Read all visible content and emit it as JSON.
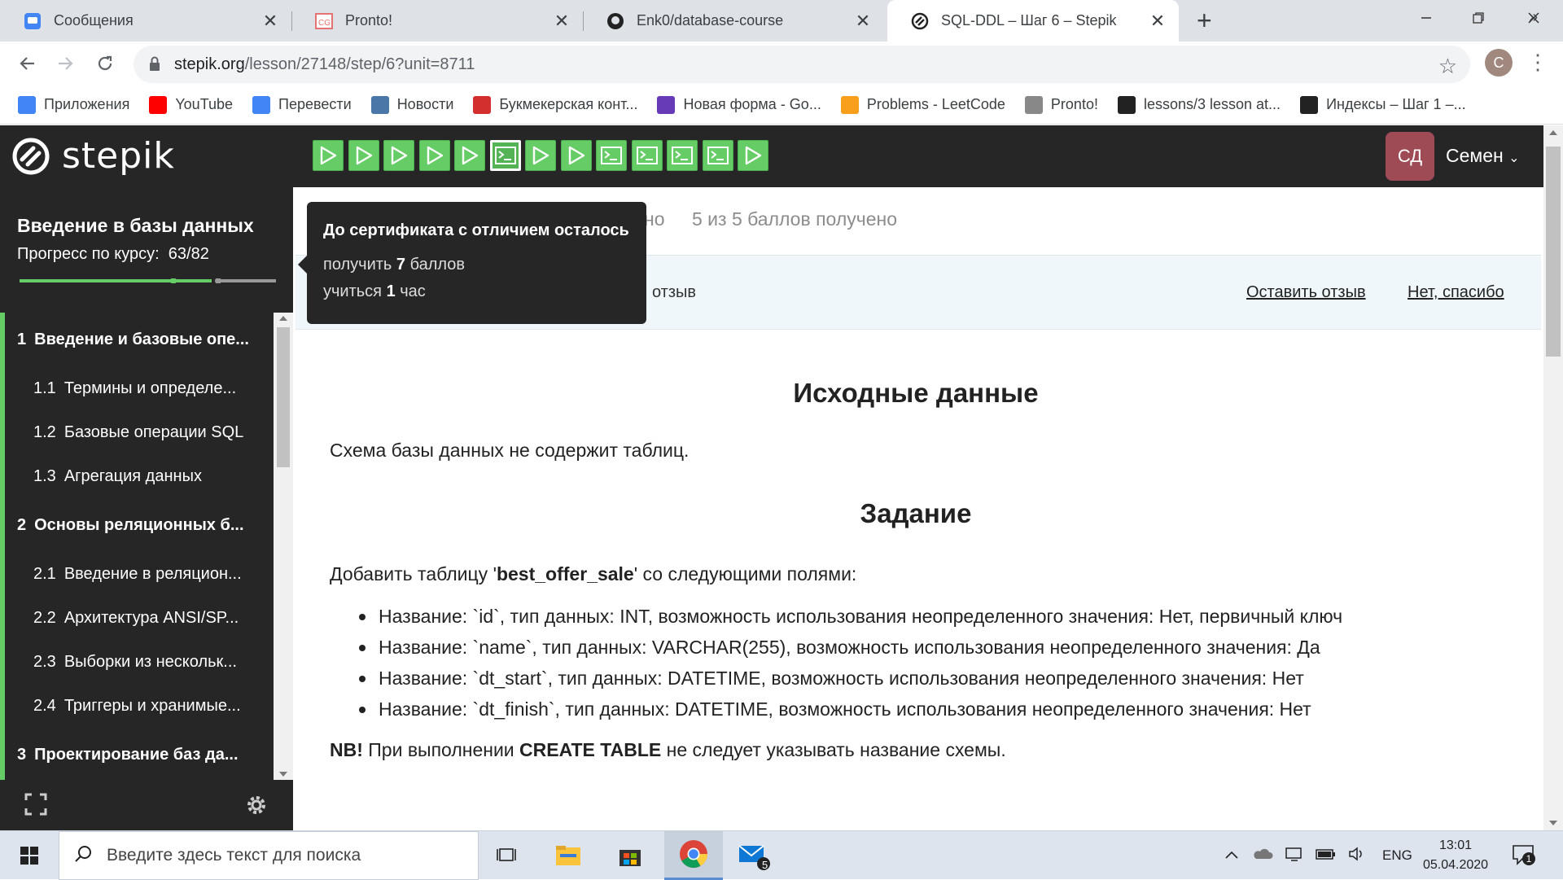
{
  "browser": {
    "tabs": [
      {
        "title": "Сообщения",
        "icon": "messages-icon",
        "active": false
      },
      {
        "title": "Pronto!",
        "icon": "cg-icon",
        "active": false
      },
      {
        "title": "Enk0/database-course",
        "icon": "github-icon",
        "active": false
      },
      {
        "title": "SQL-DDL – Шаг 6 – Stepik",
        "icon": "stepik-icon",
        "active": true
      }
    ],
    "new_tab": "+",
    "url_host": "stepik.org",
    "url_path": "/lesson/27148/step/6?unit=8711",
    "profile_initial": "С",
    "bookmarks": [
      {
        "label": "Приложения",
        "icon": "apps-icon",
        "color": "#4285f4"
      },
      {
        "label": "YouTube",
        "icon": "youtube-icon",
        "color": "#ff0000"
      },
      {
        "label": "Перевести",
        "icon": "translate-icon",
        "color": "#4285f4"
      },
      {
        "label": "Новости",
        "icon": "vk-icon",
        "color": "#4a76a8"
      },
      {
        "label": "Букмекерская конт...",
        "icon": "bookmaker-icon",
        "color": "#d32f2f"
      },
      {
        "label": "Новая форма - Go...",
        "icon": "forms-icon",
        "color": "#673ab7"
      },
      {
        "label": "Problems - LeetCode",
        "icon": "leetcode-icon",
        "color": "#f89f1b"
      },
      {
        "label": "Pronto!",
        "icon": "cg-icon",
        "color": "#888888"
      },
      {
        "label": "lessons/3 lesson at...",
        "icon": "github-icon",
        "color": "#222222"
      },
      {
        "label": "Индексы – Шаг 1 –...",
        "icon": "stepik-icon",
        "color": "#222222"
      }
    ],
    "bookmarks_more": "»"
  },
  "stepik": {
    "logo": "stepik",
    "steps": [
      "passed",
      "passed",
      "passed",
      "passed",
      "passed",
      "code-current",
      "passed",
      "passed",
      "code",
      "code",
      "code",
      "code",
      "passed"
    ],
    "user_initials": "СД",
    "user_name": "Семен",
    "user_caret": "⌄"
  },
  "sidebar": {
    "course_title": "Введение в базы данных",
    "progress_label": "Прогресс по курсу:",
    "progress_value": "63/82",
    "progress_fraction": 0.768,
    "toc": [
      {
        "type": "section",
        "num": "1",
        "label": "Введение и базовые опе..."
      },
      {
        "type": "lesson",
        "num": "1.1",
        "label": "Термины и определе..."
      },
      {
        "type": "lesson",
        "num": "1.2",
        "label": "Базовые операции SQL"
      },
      {
        "type": "lesson",
        "num": "1.3",
        "label": "Агрегация данных"
      },
      {
        "type": "section",
        "num": "2",
        "label": "Основы реляционных б..."
      },
      {
        "type": "lesson",
        "num": "2.1",
        "label": "Введение в реляцион..."
      },
      {
        "type": "lesson",
        "num": "2.2",
        "label": "Архитектура ANSI/SP..."
      },
      {
        "type": "lesson",
        "num": "2.3",
        "label": "Выборки из нескольк..."
      },
      {
        "type": "lesson",
        "num": "2.4",
        "label": "Триггеры и хранимые..."
      },
      {
        "type": "section",
        "num": "3",
        "label": "Проектирование баз да..."
      }
    ]
  },
  "main": {
    "score_left": "но",
    "score_text": "5 из 5 баллов  получено",
    "feedback_text": "отзыв",
    "feedback_leave": "Оставить отзыв",
    "feedback_no": "Нет, спасибо",
    "heading_source": "Исходные данные",
    "schema_text": "Схема базы данных не содержит таблиц.",
    "heading_task": "Задание",
    "task_intro_before": "Добавить таблицу '",
    "task_table": "best_offer_sale",
    "task_intro_after": "' со следующими полями:",
    "fields": [
      "Название: `id`, тип данных: INT, возможность использования неопределенного значения: Нет, первичный ключ",
      "Название: `name`, тип данных: VARCHAR(255), возможность использования неопределенного значения: Да",
      "Название: `dt_start`, тип данных: DATETIME, возможность использования неопределенного значения: Нет",
      "Название: `dt_finish`, тип данных: DATETIME, возможность использования неопределенного значения: Нет"
    ],
    "nb_label": "NB!",
    "nb_before": " При выполнении ",
    "nb_cmd": "CREATE TABLE",
    "nb_after": " не следует указывать название схемы."
  },
  "tooltip": {
    "title": "До сертификата с отличием осталось",
    "line1_before": "получить ",
    "line1_value": "7",
    "line1_after": " баллов",
    "line2_before": "учиться ",
    "line2_value": "1",
    "line2_after": " час"
  },
  "taskbar": {
    "search_placeholder": "Введите здесь текст для поиска",
    "mail_badge": "5",
    "lang": "ENG",
    "time": "13:01",
    "date": "05.04.2020",
    "notif_count": "1"
  }
}
